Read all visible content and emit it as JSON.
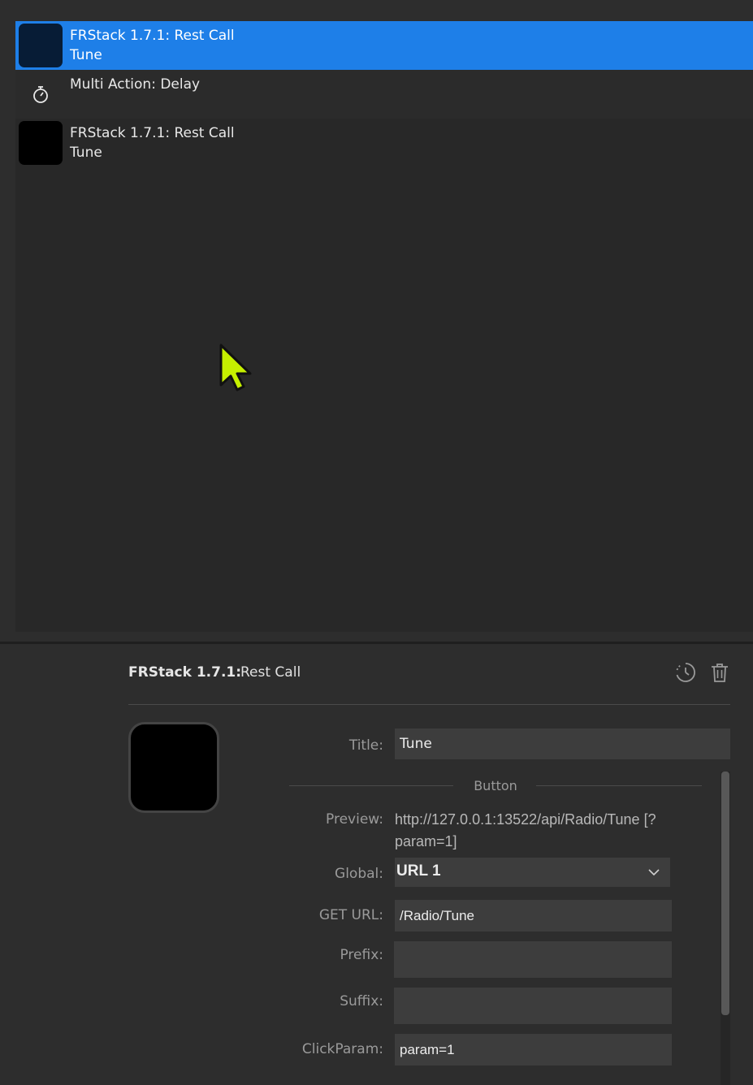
{
  "action_list": {
    "items": [
      {
        "title": "FRStack 1.7.1: Rest Call",
        "subtitle": "Tune",
        "selected": true
      },
      {
        "title": "Multi Action: Delay",
        "subtitle": "",
        "icon": "stopwatch-icon"
      },
      {
        "title": "FRStack 1.7.1: Rest Call",
        "subtitle": "Tune",
        "selected": false
      }
    ]
  },
  "inspector": {
    "plugin_name": "FRStack 1.7.1:",
    "action_name": "Rest Call",
    "icons": [
      "history-icon",
      "trash-icon"
    ],
    "title_label": "Title:",
    "title_value": "Tune",
    "section_label": "Button",
    "preview_label": "Preview:",
    "preview_value": "http://127.0.0.1:13522/api/Radio/Tune [?param=1]",
    "global_label": "Global:",
    "global_value": "URL 1",
    "get_url_label": "GET URL:",
    "get_url_value": "/Radio/Tune",
    "prefix_label": "Prefix:",
    "prefix_value": "",
    "suffix_label": "Suffix:",
    "suffix_value": "",
    "clickparam_label": "ClickParam:",
    "clickparam_value": "param=1"
  },
  "colors": {
    "selection": "#1e7fe8",
    "background": "#2d2d2d",
    "list_background": "#282828",
    "input_background": "#3d3d3d",
    "cursor": "#c6f000"
  }
}
